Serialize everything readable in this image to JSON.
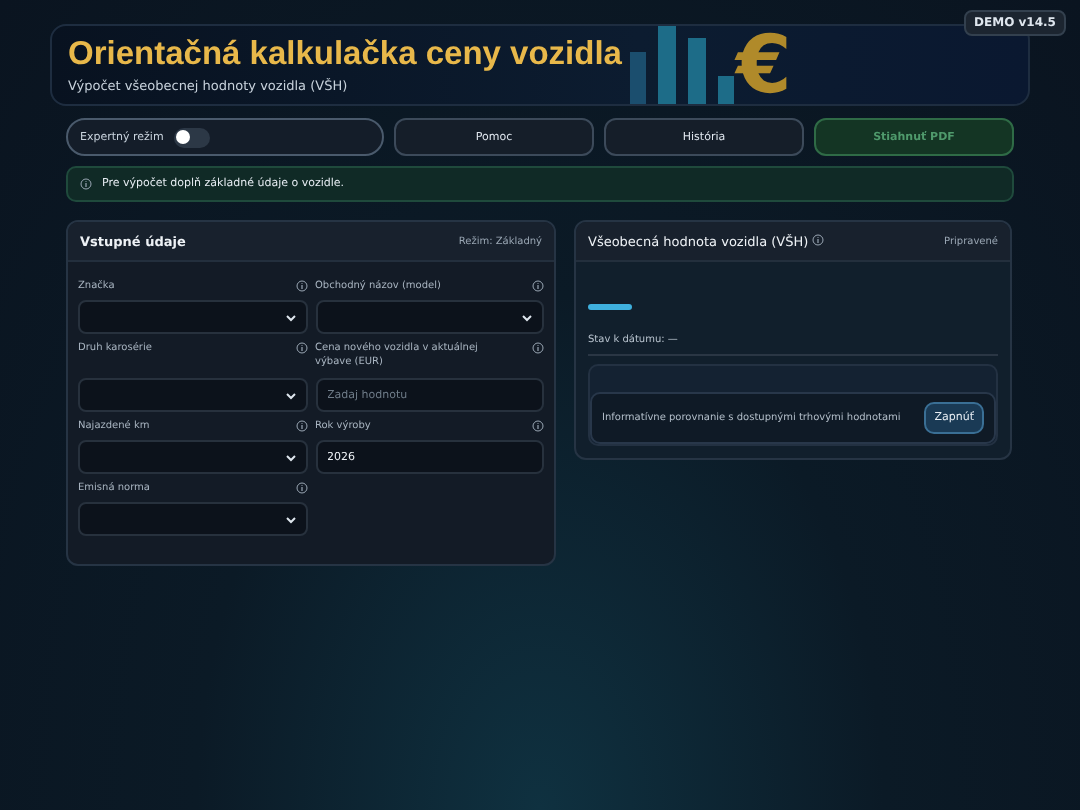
{
  "badge": "DEMO v14.5",
  "header": {
    "title": "Orientačná kalkulačka ceny vozidla",
    "subtitle": "Výpočet všeobecnej hodnoty vozidla (VŠH)",
    "symbol": "€"
  },
  "toolbar": {
    "expert": {
      "label": "Expertný režim",
      "on": false
    },
    "buttons": [
      {
        "label": "Pomoc",
        "disabled": false
      },
      {
        "label": "História",
        "disabled": false
      },
      {
        "label": "Stiahnuť PDF",
        "disabled": true
      }
    ]
  },
  "notice": {
    "text": "Pre výpočet doplň základné údaje o vozidle."
  },
  "input_panel": {
    "title": "Vstupné údaje",
    "mode": "Režim: Základný",
    "fields": [
      {
        "label": "Značka",
        "kind": "select"
      },
      {
        "label": "Obchodný názov (model)",
        "kind": "select"
      },
      {
        "label": "Druh karosérie",
        "kind": "select"
      },
      {
        "label": "Cena nového vozidla v aktuálnej výbave (EUR)",
        "kind": "input",
        "placeholder": "Zadaj hodnotu"
      },
      {
        "label": "Najazdené km",
        "kind": "select"
      },
      {
        "label": "Rok výroby",
        "kind": "input",
        "value": "2026"
      },
      {
        "label": "Emisná norma",
        "kind": "select"
      }
    ]
  },
  "result_panel": {
    "title": "Všeobecná hodnota vozidla (VŠH)",
    "status": "Pripravené",
    "date_label": "Stav k dátumu: —",
    "compare": {
      "text": "Informatívne porovnanie s dostupnými trhovými hodnotami",
      "button": "Zapnúť"
    }
  }
}
